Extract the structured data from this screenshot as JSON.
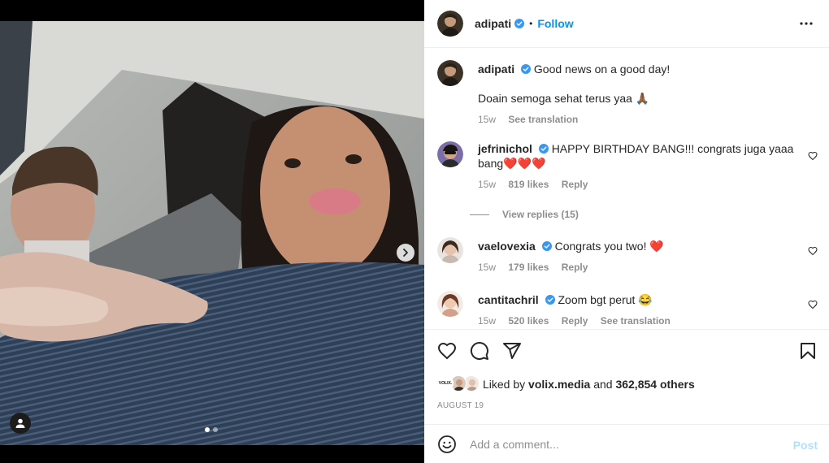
{
  "post": {
    "author": "adipati",
    "follow_label": "Follow",
    "separator": "•"
  },
  "caption": {
    "user": "adipati",
    "line1": "Good news on a good day!",
    "line2": "Doain semoga sehat terus yaa 🙏🏾",
    "time": "15w",
    "see_translation": "See translation"
  },
  "comments": [
    {
      "user": "jefrinichol",
      "text": "HAPPY BIRTHDAY BANG!!! congrats juga yaaa bang❤️❤️❤️",
      "time": "15w",
      "likes": "819 likes",
      "reply": "Reply",
      "view_replies": "View replies (15)"
    },
    {
      "user": "vaelovexia",
      "text": "Congrats you two! ❤️",
      "time": "15w",
      "likes": "179 likes",
      "reply": "Reply"
    },
    {
      "user": "cantitachril",
      "text": "Zoom bgt perut 😂",
      "time": "15w",
      "likes": "520 likes",
      "reply": "Reply",
      "see_translation": "See translation"
    }
  ],
  "liked_by": {
    "prefix": "Liked by",
    "user": "volix.media",
    "middle": "and",
    "others": "362,854 others",
    "avatar_label": "VOLIX."
  },
  "date": "AUGUST 19",
  "add_comment": {
    "placeholder": "Add a comment...",
    "post_label": "Post"
  },
  "colors": {
    "accent": "#0095f6",
    "verified": "#3897f0",
    "post_disabled": "#b2dffc",
    "heart": "#ed1c24"
  },
  "icons": {
    "verified": "verified-badge-icon",
    "more": "more-options-icon",
    "heart": "heart-icon",
    "comment": "comment-icon",
    "share": "share-icon",
    "save": "bookmark-icon",
    "emoji": "emoji-icon",
    "next": "chevron-right-icon",
    "user_tag": "user-tag-icon"
  },
  "carousel": {
    "current": 1,
    "total": 2
  }
}
